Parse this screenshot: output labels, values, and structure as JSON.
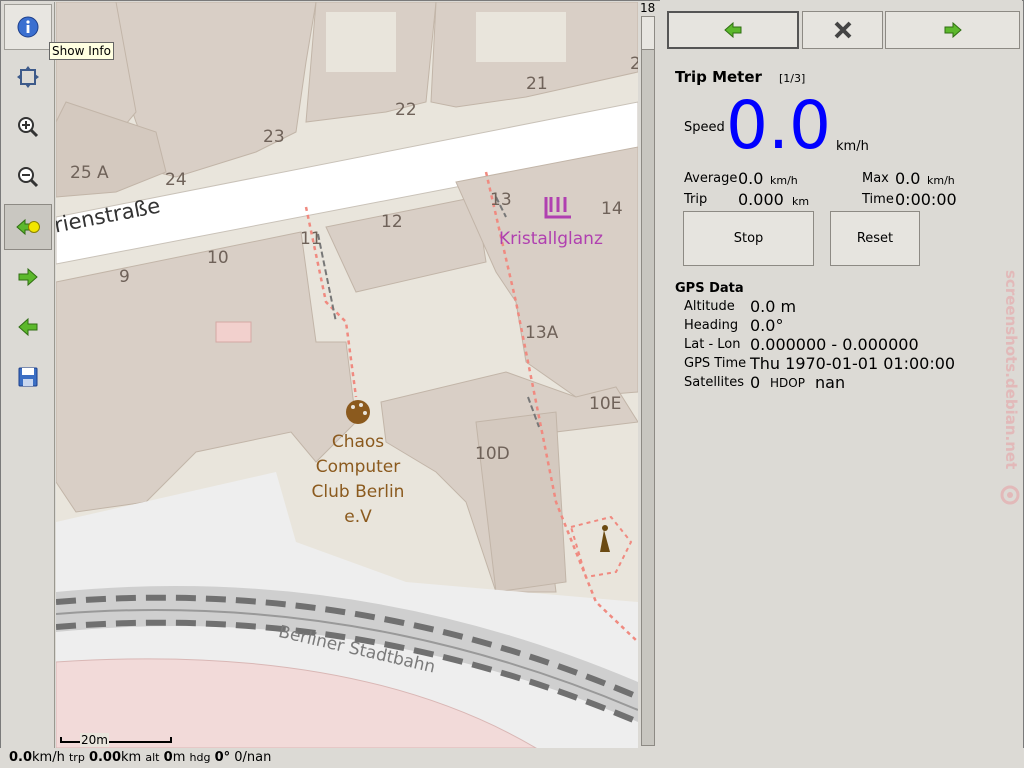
{
  "toolbar": {
    "tooltip": "Show Info",
    "buttons": [
      "info-icon",
      "fit-icon",
      "zoom-in-icon",
      "zoom-out-icon",
      "gps-follow-icon",
      "forward-arrow-icon",
      "back-arrow-icon",
      "save-icon"
    ]
  },
  "map": {
    "street": "Marienstraße",
    "street_visible": "rienstraße",
    "house_numbers": [
      "23",
      "22",
      "21",
      "2",
      "25 A",
      "24",
      "13",
      "14",
      "12",
      "11",
      "10",
      "9",
      "13A",
      "10E",
      "10D"
    ],
    "poi1": "Kristallglanz",
    "poi2_lines": [
      "Chaos",
      "Computer",
      "Club Berlin",
      "e.V"
    ],
    "railway": "Berliner Stadtbahn",
    "scale": "20m"
  },
  "zoom": {
    "level": "18"
  },
  "panel": {
    "title": "Trip Meter",
    "page": "[1/3]",
    "speed_label": "Speed",
    "speed_value": "0.0",
    "speed_unit": "km/h",
    "average_label": "Average",
    "average_value": "0.0",
    "average_unit": "km/h",
    "max_label": "Max",
    "max_value": "0.0",
    "max_unit": "km/h",
    "trip_label": "Trip",
    "trip_value": "0.000",
    "trip_unit": "km",
    "time_label": "Time",
    "time_value": "0:00:00",
    "stop_label": "Stop",
    "reset_label": "Reset",
    "gps_title": "GPS Data",
    "altitude_label": "Altitude",
    "altitude_value": "0.0 m",
    "heading_label": "Heading",
    "heading_value": "0.0°",
    "latlon_label": "Lat - Lon",
    "latlon_value": "0.000000 - 0.000000",
    "gpstime_label": "GPS Time",
    "gpstime_value": "Thu 1970-01-01 01:00:00",
    "satellites_label": "Satellites",
    "satellites_value": "0",
    "hdop_label": "HDOP",
    "hdop_value": "nan"
  },
  "status": {
    "speed": "0.0",
    "speed_unit": "km/h",
    "trp_label": "trp",
    "trp": "0.00",
    "trp_unit": "km",
    "alt_label": "alt",
    "alt": "0",
    "alt_unit": "m",
    "hdg_label": "hdg",
    "hdg": "0°",
    "sat": "0/nan"
  },
  "watermark": "screenshots.debian.net",
  "colors": {
    "speed": "#0000ff",
    "arrow_green": "#5cb82c",
    "poi_magenta": "#b040b0",
    "poi_brown": "#8b5a1e"
  }
}
